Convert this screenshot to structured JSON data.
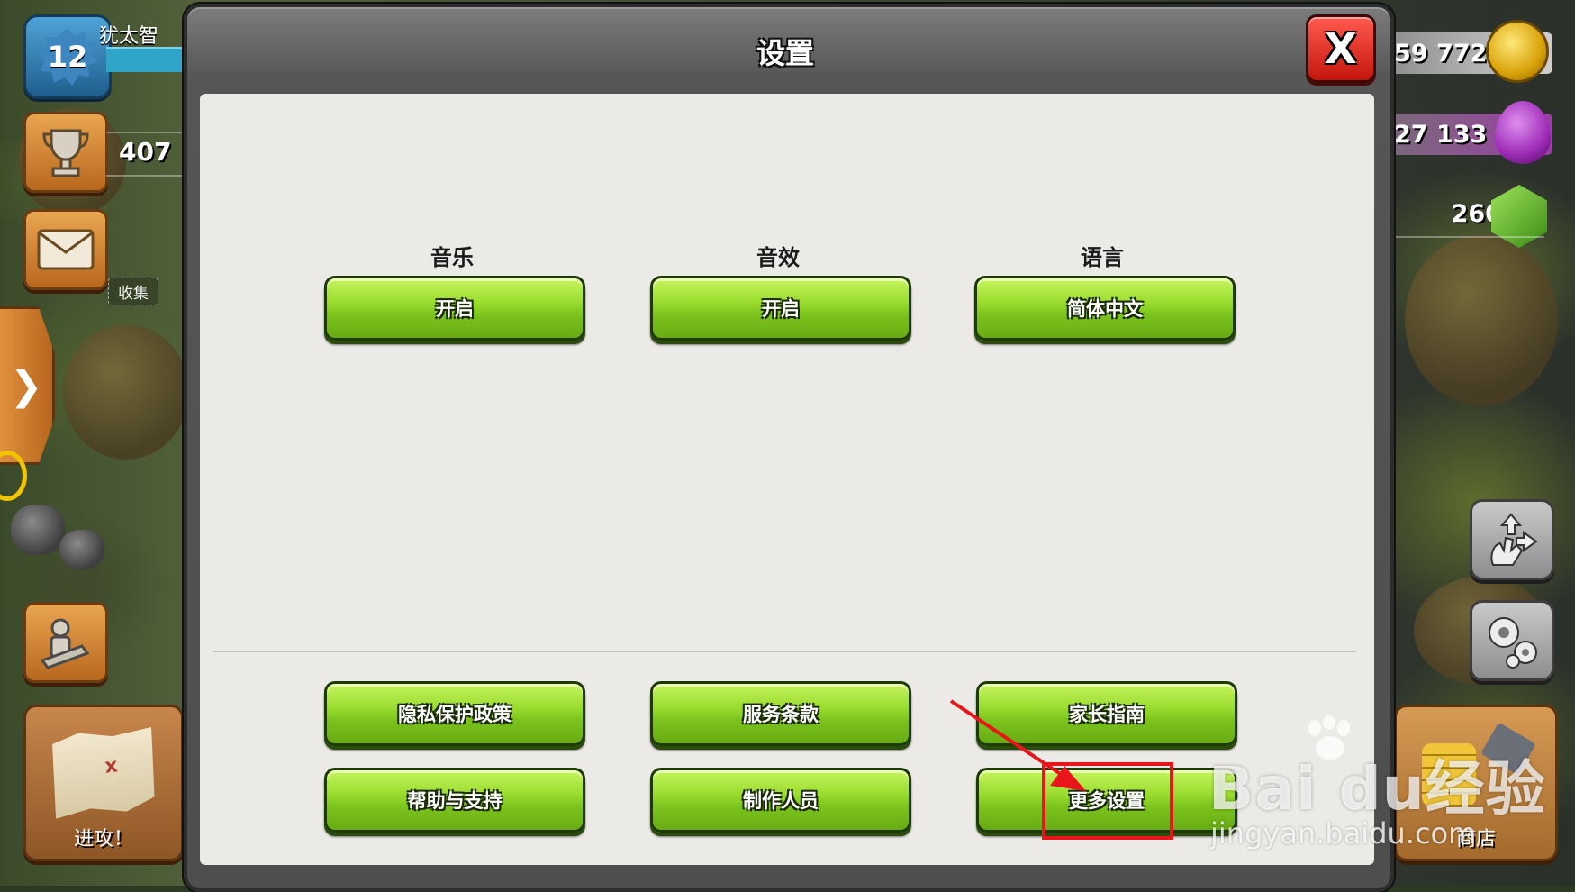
{
  "hud": {
    "player": {
      "level": "12",
      "name": "犹太智"
    },
    "trophies": "407",
    "collect_label": "收集",
    "attack_label": "进攻！",
    "shop_label": "商店",
    "side_tab_glyph": "❯",
    "resources": {
      "gold": "59 772",
      "elixir": "27 133",
      "gems": "260"
    },
    "icons": [
      "trophy-icon",
      "mail-icon",
      "builder-icon",
      "map-icon",
      "gold-icon",
      "elixir-icon",
      "gem-icon",
      "move-gesture-icon",
      "gear-icon"
    ]
  },
  "dialog": {
    "title": "设置",
    "close_label": "X",
    "options": [
      {
        "label": "音乐",
        "value": "开启"
      },
      {
        "label": "音效",
        "value": "开启"
      },
      {
        "label": "语言",
        "value": "简体中文"
      }
    ],
    "links": [
      "隐私保护政策",
      "服务条款",
      "家长指南",
      "帮助与支持",
      "制作人员",
      "更多设置"
    ]
  },
  "annotation": {
    "highlight_color": "#e8161b",
    "target": "更多设置"
  },
  "watermark": {
    "brand": "Bai  du经验",
    "url": "jingyan.baidu.com"
  },
  "colors": {
    "button_green": "#7cc41d",
    "close_red": "#c4160d",
    "panel": "#ebeae6"
  }
}
